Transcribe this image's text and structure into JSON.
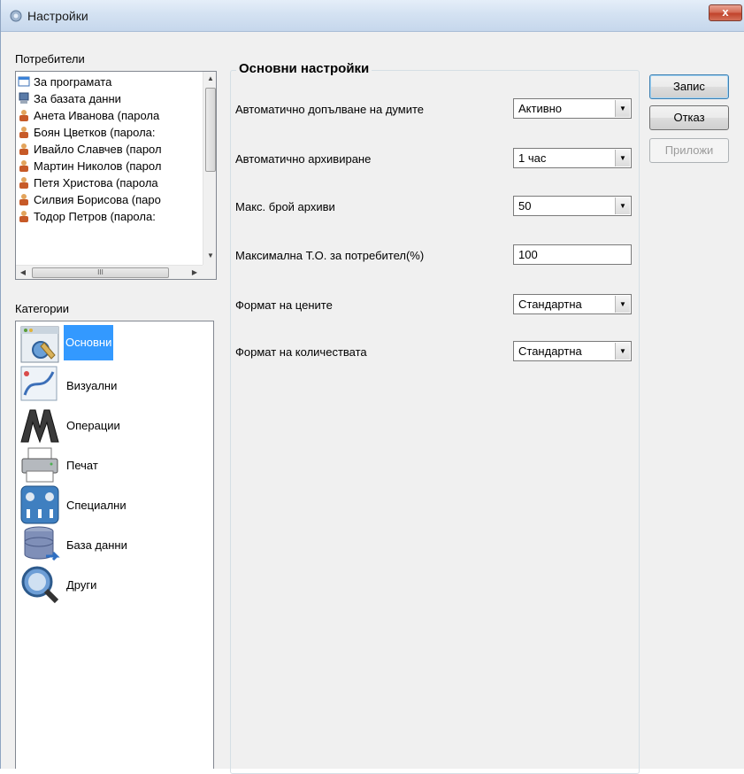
{
  "window": {
    "title": "Настройки",
    "close_glyph": "x",
    "app_icon": "settings-gear-icon"
  },
  "users": {
    "label": "Потребители",
    "items": [
      {
        "label": "За програмата",
        "icon": "program-window-icon"
      },
      {
        "label": "За базата данни",
        "icon": "computer-icon"
      },
      {
        "label": "Анета Иванова (парола",
        "icon": "user-icon"
      },
      {
        "label": "Боян Цветков (парола:",
        "icon": "user-icon"
      },
      {
        "label": "Ивайло Славчев (парол",
        "icon": "user-icon"
      },
      {
        "label": "Мартин Николов (парол",
        "icon": "user-icon"
      },
      {
        "label": "Петя Христова (парола",
        "icon": "user-icon"
      },
      {
        "label": "Силвия Борисова (паро",
        "icon": "user-icon"
      },
      {
        "label": "Тодор Петров (парола:",
        "icon": "user-icon"
      }
    ],
    "hscroll_grip": "III"
  },
  "categories": {
    "label": "Категории",
    "items": [
      {
        "label": "Основни",
        "icon": "basic-settings-icon",
        "selected": true
      },
      {
        "label": "Визуални",
        "icon": "visual-icon",
        "selected": false
      },
      {
        "label": "Операции",
        "icon": "operations-icon",
        "selected": false
      },
      {
        "label": "Печат",
        "icon": "printer-icon",
        "selected": false
      },
      {
        "label": "Специални",
        "icon": "special-icon",
        "selected": false
      },
      {
        "label": "База данни",
        "icon": "database-icon",
        "selected": false
      },
      {
        "label": "Други",
        "icon": "other-icon",
        "selected": false
      }
    ]
  },
  "main": {
    "group_title": "Основни настройки",
    "fields": [
      {
        "label": "Автоматично допълване на думите",
        "type": "combo",
        "value": "Активно"
      },
      {
        "label": "Автоматично архивиране",
        "type": "combo",
        "value": "1 час"
      },
      {
        "label": "Макс. брой архиви",
        "type": "combo",
        "value": "50"
      },
      {
        "label": "Максимална Т.О. за потребител(%)",
        "type": "text",
        "value": "100"
      },
      {
        "label": "Формат на цените",
        "type": "combo",
        "value": "Стандартна"
      },
      {
        "label": "Формат на количествата",
        "type": "combo",
        "value": "Стандартна"
      }
    ]
  },
  "buttons": {
    "save": "Запис",
    "cancel": "Отказ",
    "apply": "Приложи"
  },
  "colors": {
    "selection": "#3399ff",
    "window_bg": "#f0f0f0",
    "close_button": "#c1432b"
  }
}
